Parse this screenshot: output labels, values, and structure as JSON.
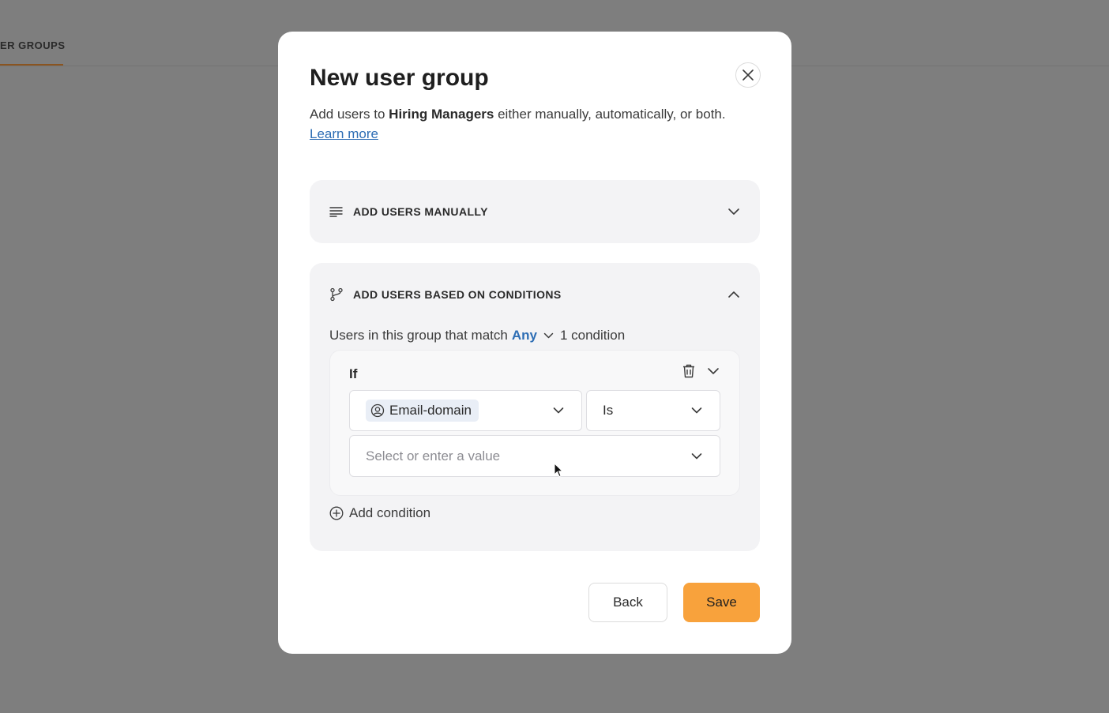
{
  "background": {
    "tab_label": "ER GROUPS"
  },
  "modal": {
    "title": "New user group",
    "description_prefix": "Add users to ",
    "group_name": "Hiring Managers",
    "description_suffix": " either manually, automatically, or both.",
    "learn_more": "Learn more",
    "close_icon": "close-icon"
  },
  "manual_section": {
    "title": "ADD USERS MANUALLY",
    "icon": "list-lines-icon",
    "expanded": false
  },
  "conditions_section": {
    "title": "ADD USERS BASED ON CONDITIONS",
    "icon": "branch-icon",
    "expanded": true,
    "match_prefix": "Users in this group that match",
    "match_mode": "Any",
    "condition_count": "1 condition",
    "condition": {
      "if_label": "If",
      "field": "Email-domain",
      "operator": "Is",
      "value_placeholder": "Select or enter a value"
    },
    "add_condition": "Add condition"
  },
  "footer": {
    "back_label": "Back",
    "save_label": "Save"
  },
  "colors": {
    "accent": "#f8a23c",
    "link": "#2d6db4",
    "overlay": "#7e7e7e"
  }
}
